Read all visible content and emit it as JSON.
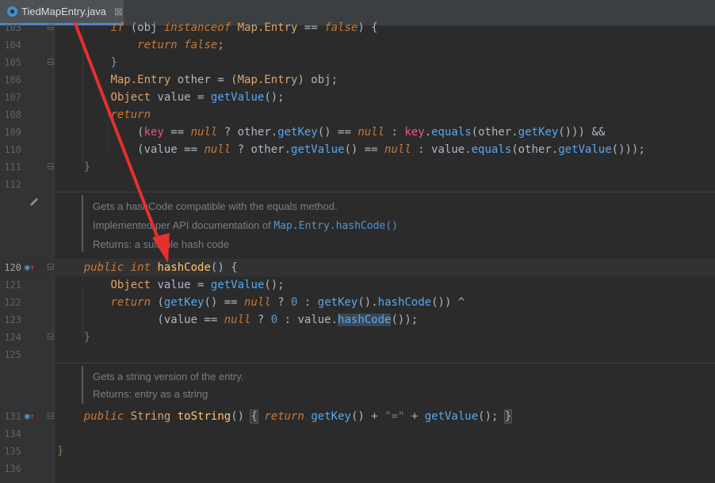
{
  "tab": {
    "filename": "TiedMapEntry.java",
    "close": "⊠"
  },
  "lines": {
    "l103": "103",
    "l104": "104",
    "l105": "105",
    "l106": "106",
    "l107": "107",
    "l108": "108",
    "l109": "109",
    "l110": "110",
    "l111": "111",
    "l112": "112",
    "l120": "120",
    "l121": "121",
    "l122": "122",
    "l123": "123",
    "l124": "124",
    "l125": "125",
    "l131": "131",
    "l134": "134",
    "l135": "135",
    "l136": "136"
  },
  "doc1": {
    "line1": "Gets a hashCode compatible with the equals method.",
    "line2_prefix": "Implemented per API documentation of ",
    "line2_link": "Map.Entry.hashCode()",
    "line3": "Returns: a suitable hash code"
  },
  "doc2": {
    "line1": "Gets a string version of the entry.",
    "line2": "Returns: entry as a string"
  },
  "colors": {
    "background": "#2b2b2b",
    "keyword": "#cc7832",
    "method": "#ffc66d",
    "annotation_arrow": "#e63030",
    "tab_accent": "#4a88c7"
  },
  "icons": {
    "tab": "java-class-icon",
    "gutter_override": "override-method-icon",
    "gutter_edit": "pencil-icon"
  }
}
